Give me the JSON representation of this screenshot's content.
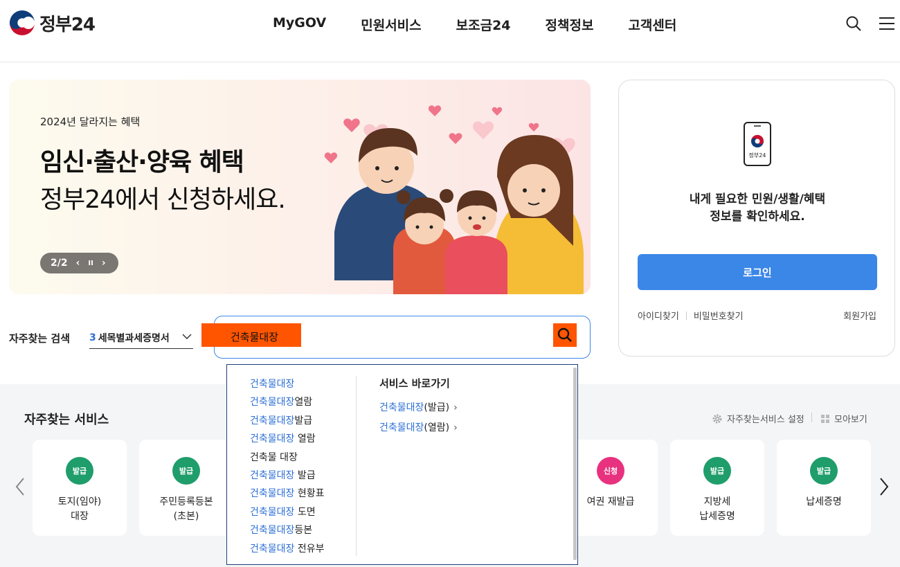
{
  "header": {
    "logo_text": "정부24",
    "nav": [
      "MyGOV",
      "민원서비스",
      "보조금24",
      "정책정보",
      "고객센터"
    ]
  },
  "banner": {
    "subtitle": "2024년 달라지는 혜택",
    "title_line1": "임신·출산·양육 혜택",
    "title_line2": "정부24에서 신청하세요.",
    "pager": "2/2"
  },
  "login": {
    "phone_label": "정부24",
    "message_line1": "내게 필요한 민원/생활/혜택",
    "message_line2": "정보를 확인하세요.",
    "button": "로그인",
    "find_id": "아이디찾기",
    "find_pw": "비밀번호찾기",
    "join": "회원가입"
  },
  "search": {
    "freq_label": "자주찾는 검색",
    "freq_select_num": "3",
    "freq_select_text": "세목별과세증명서",
    "query": "건축물대장"
  },
  "autocomplete": {
    "items": [
      {
        "match": "건축물대장",
        "rest": ""
      },
      {
        "match": "건축물대장",
        "rest": "열람"
      },
      {
        "match": "건축물대장",
        "rest": "발급"
      },
      {
        "match": "건축물대장",
        "rest": " 열람"
      },
      {
        "match": "",
        "rest": "건축물 대장"
      },
      {
        "match": "건축물대장",
        "rest": " 발급"
      },
      {
        "match": "건축물대장",
        "rest": " 현황표"
      },
      {
        "match": "건축물대장",
        "rest": " 도면"
      },
      {
        "match": "건축물대장",
        "rest": "등본"
      },
      {
        "match": "건축물대장",
        "rest": " 전유부"
      }
    ],
    "shortcut_title": "서비스 바로가기",
    "shortcuts": [
      {
        "match": "건축물대장",
        "rest": "(발급)"
      },
      {
        "match": "건축물대장",
        "rest": "(열람)"
      }
    ]
  },
  "services": {
    "title": "자주찾는 서비스",
    "setting": "자주찾는서비스 설정",
    "view_all": "모아보기",
    "cards": [
      {
        "badge": "발급",
        "name": "토지(임야)\n대장",
        "color": "#1f9d6b"
      },
      {
        "badge": "발급",
        "name": "주민등록등본\n(초본)",
        "color": "#1f9d6b"
      },
      {
        "badge": "신청",
        "name": "여권 재발급",
        "color": "#e8327f"
      },
      {
        "badge": "발급",
        "name": "지방세\n납세증명",
        "color": "#1f9d6b"
      },
      {
        "badge": "발급",
        "name": "납세증명",
        "color": "#1f9d6b"
      }
    ]
  }
}
